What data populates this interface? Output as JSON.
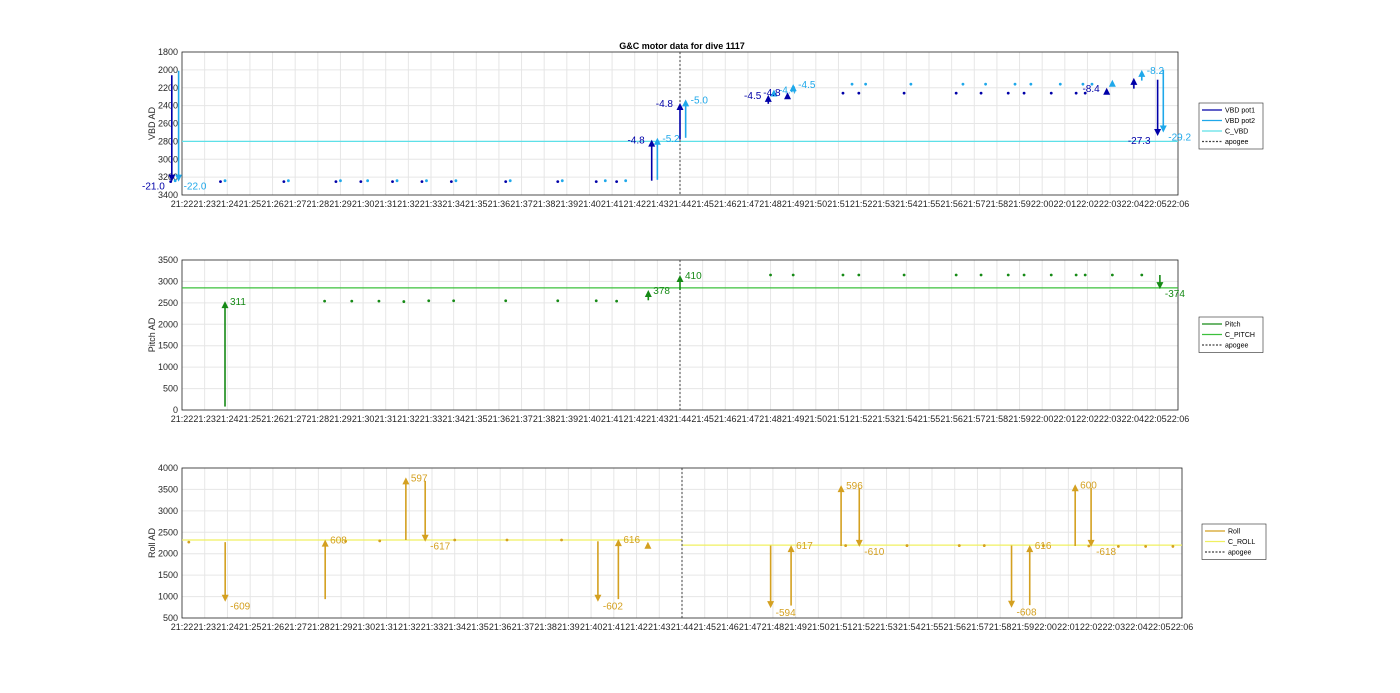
{
  "title": "G&C motor data for dive 1117",
  "colors": {
    "vbd_pot1": "#0000a8",
    "vbd_pot2": "#1fa8ea",
    "c_vbd": "#5ee0e8",
    "pitch": "#168a16",
    "c_pitch": "#3cc03c",
    "roll": "#d4a020",
    "c_roll": "#f0f060",
    "apogee": "#404040",
    "grid": "#e6e6e6"
  },
  "time_ticks": [
    "21:22",
    "21:23",
    "21:24",
    "21:25",
    "21:26",
    "21:27",
    "21:28",
    "21:29",
    "21:30",
    "21:31",
    "21:32",
    "21:33",
    "21:34",
    "21:35",
    "21:36",
    "21:37",
    "21:38",
    "21:39",
    "21:40",
    "21:41",
    "21:42",
    "21:43",
    "21:44",
    "21:45",
    "21:46",
    "21:47",
    "21:48",
    "21:49",
    "21:50",
    "21:51",
    "21:52",
    "21:53",
    "21:54",
    "21:55",
    "21:56",
    "21:57",
    "21:58",
    "21:59",
    "22:00",
    "22:01",
    "22:02",
    "22:03",
    "22:04",
    "22:05",
    "22:06"
  ],
  "chart_data": [
    {
      "type": "line",
      "title": "G&C motor data for dive 1117",
      "ylabel": "VBD AD",
      "xlabel": "",
      "xlim": [
        "21:22",
        "22:06"
      ],
      "ylim": [
        1800,
        3400
      ],
      "y_reversed": true,
      "yticks": [
        1800,
        2000,
        2200,
        2400,
        2600,
        2800,
        3000,
        3200,
        3400
      ],
      "apogee": "21:44",
      "legend": [
        "VBD pot1",
        "VBD pot2",
        "C_VBD",
        "apogee"
      ],
      "legend_position": "right",
      "series": [
        {
          "name": "VBD pot1",
          "points": [
            [
              21.5,
              3250
            ],
            [
              23.7,
              3250
            ],
            [
              26.5,
              3250
            ],
            [
              28.8,
              3250
            ],
            [
              29.9,
              3250
            ],
            [
              31.3,
              3250
            ],
            [
              32.6,
              3250
            ],
            [
              33.9,
              3250
            ],
            [
              36.3,
              3250
            ],
            [
              38.6,
              3250
            ],
            [
              40.3,
              3250
            ],
            [
              41.2,
              3250
            ],
            [
              51.2,
              2260
            ],
            [
              51.9,
              2260
            ],
            [
              53.9,
              2260
            ],
            [
              56.2,
              2260
            ],
            [
              57.3,
              2260
            ],
            [
              58.5,
              2260
            ],
            [
              59.2,
              2260
            ],
            [
              60.4,
              2260
            ],
            [
              61.5,
              2260
            ],
            [
              61.9,
              2260
            ]
          ]
        },
        {
          "name": "VBD pot2",
          "points": [
            [
              21.7,
              3240
            ],
            [
              23.9,
              3240
            ],
            [
              26.7,
              3240
            ],
            [
              29.0,
              3240
            ],
            [
              30.2,
              3240
            ],
            [
              31.5,
              3240
            ],
            [
              32.8,
              3240
            ],
            [
              34.1,
              3240
            ],
            [
              36.5,
              3240
            ],
            [
              38.8,
              3240
            ],
            [
              40.7,
              3240
            ],
            [
              41.6,
              3240
            ],
            [
              51.6,
              2160
            ],
            [
              52.2,
              2160
            ],
            [
              54.2,
              2160
            ],
            [
              56.5,
              2160
            ],
            [
              57.5,
              2160
            ],
            [
              58.8,
              2160
            ],
            [
              59.5,
              2160
            ],
            [
              60.8,
              2160
            ],
            [
              61.8,
              2160
            ],
            [
              62.2,
              2160
            ]
          ]
        },
        {
          "name": "C_VBD",
          "value": 2800
        }
      ],
      "moves": [
        {
          "series": "VBD pot1",
          "t": 21.55,
          "from": 2060,
          "to": 3250,
          "label": "-21.0"
        },
        {
          "series": "VBD pot2",
          "t": 21.85,
          "from": 2010,
          "to": 3250,
          "label": "-22.0"
        },
        {
          "series": "VBD pot1",
          "t": 42.75,
          "from": 3240,
          "to": 2780,
          "label": "-4.8"
        },
        {
          "series": "VBD pot2",
          "t": 43.0,
          "from": 3230,
          "to": 2760,
          "label": "-5.2"
        },
        {
          "series": "VBD pot1",
          "t": 44.0,
          "from": 2780,
          "to": 2370,
          "label": "-4.8"
        },
        {
          "series": "VBD pot2",
          "t": 44.25,
          "from": 2760,
          "to": 2330,
          "label": "-5.0"
        },
        {
          "series": "VBD pot1",
          "t": 47.9,
          "from": 2380,
          "to": 2280,
          "label": "-4.5"
        },
        {
          "series": "VBD pot2",
          "t": 48.15,
          "from": 2280,
          "to": 2220,
          "label": "-4.4"
        },
        {
          "series": "VBD pot1",
          "t": 48.75,
          "from": 2300,
          "to": 2250,
          "label": "-4.8"
        },
        {
          "series": "VBD pot2",
          "t": 49.0,
          "from": 2210,
          "to": 2160,
          "label": "-4.5"
        },
        {
          "series": "VBD pot1",
          "t": 62.85,
          "from": 2250,
          "to": 2200,
          "label": "-8.4"
        },
        {
          "series": "VBD pot2",
          "t": 63.1,
          "from": 2160,
          "to": 2110,
          "label": ""
        },
        {
          "series": "VBD pot1",
          "t": 64.05,
          "from": 2210,
          "to": 2090,
          "label": ""
        },
        {
          "series": "VBD pot2",
          "t": 64.4,
          "from": 2120,
          "to": 2000,
          "label": "-8.2"
        },
        {
          "series": "VBD pot1",
          "t": 65.1,
          "from": 2110,
          "to": 2740,
          "label": "-27.3"
        },
        {
          "series": "VBD pot2",
          "t": 65.35,
          "from": 2000,
          "to": 2700,
          "label": "-29.2"
        }
      ]
    },
    {
      "type": "line",
      "ylabel": "Pitch AD",
      "xlabel": "",
      "xlim": [
        "21:22",
        "22:06"
      ],
      "ylim": [
        0,
        3500
      ],
      "yticks": [
        0,
        500,
        1000,
        1500,
        2000,
        2500,
        3000,
        3500
      ],
      "apogee": "21:44",
      "legend": [
        "Pitch",
        "C_PITCH",
        "apogee"
      ],
      "legend_position": "right",
      "series": [
        {
          "name": "Pitch",
          "points": [
            [
              28.3,
              2540
            ],
            [
              29.5,
              2540
            ],
            [
              30.7,
              2540
            ],
            [
              31.8,
              2530
            ],
            [
              32.9,
              2550
            ],
            [
              34.0,
              2550
            ],
            [
              36.3,
              2550
            ],
            [
              38.6,
              2550
            ],
            [
              40.3,
              2550
            ],
            [
              41.2,
              2540
            ],
            [
              48.0,
              3150
            ],
            [
              49.0,
              3150
            ],
            [
              51.2,
              3150
            ],
            [
              51.9,
              3150
            ],
            [
              53.9,
              3150
            ],
            [
              56.2,
              3150
            ],
            [
              57.3,
              3150
            ],
            [
              58.5,
              3150
            ],
            [
              59.2,
              3150
            ],
            [
              60.4,
              3150
            ],
            [
              61.5,
              3150
            ],
            [
              61.9,
              3150
            ],
            [
              63.1,
              3150
            ],
            [
              64.4,
              3150
            ]
          ]
        },
        {
          "name": "C_PITCH",
          "value": 2850
        }
      ],
      "moves": [
        {
          "series": "Pitch",
          "t": 23.9,
          "from": 80,
          "to": 2540,
          "label": "311"
        },
        {
          "series": "Pitch",
          "t": 42.6,
          "from": 2560,
          "to": 2800,
          "label": "378"
        },
        {
          "series": "Pitch",
          "t": 44.0,
          "from": 2800,
          "to": 3150,
          "label": "410"
        },
        {
          "series": "Pitch",
          "t": 65.2,
          "from": 3150,
          "to": 2820,
          "label": "-374"
        }
      ]
    },
    {
      "type": "line",
      "ylabel": "Roll AD",
      "xlabel": "",
      "xlim": [
        "21:22",
        "22:06"
      ],
      "ylim": [
        500,
        4000
      ],
      "yticks": [
        500,
        1000,
        1500,
        2000,
        2500,
        3000,
        3500,
        4000
      ],
      "apogee": "21:44",
      "legend": [
        "Roll",
        "C_ROLL",
        "apogee"
      ],
      "legend_position": "right",
      "series": [
        {
          "name": "Roll",
          "points": [
            [
              22.3,
              2270
            ],
            [
              29.2,
              2290
            ],
            [
              30.7,
              2300
            ],
            [
              34.0,
              2320
            ],
            [
              36.3,
              2320
            ],
            [
              38.7,
              2320
            ],
            [
              51.2,
              2190
            ],
            [
              53.9,
              2190
            ],
            [
              56.2,
              2190
            ],
            [
              57.3,
              2190
            ],
            [
              59.9,
              2190
            ],
            [
              61.9,
              2180
            ],
            [
              63.2,
              2170
            ],
            [
              64.4,
              2170
            ],
            [
              65.6,
              2170
            ]
          ]
        },
        {
          "name": "C_ROLL",
          "segments": [
            {
              "from": "21:22",
              "to": "21:44",
              "value": 2320
            },
            {
              "from": "21:44",
              "to": "22:06",
              "value": 2200
            }
          ]
        }
      ],
      "moves": [
        {
          "series": "Roll",
          "t": 23.9,
          "from": 2270,
          "to": 880,
          "label": "-609"
        },
        {
          "series": "Roll",
          "t": 28.3,
          "from": 940,
          "to": 2330,
          "label": "608"
        },
        {
          "series": "Roll",
          "t": 31.85,
          "from": 2320,
          "to": 3780,
          "label": "597"
        },
        {
          "series": "Roll",
          "t": 32.7,
          "from": 3700,
          "to": 2280,
          "label": "-617"
        },
        {
          "series": "Roll",
          "t": 40.3,
          "from": 2290,
          "to": 880,
          "label": "-602"
        },
        {
          "series": "Roll",
          "t": 41.2,
          "from": 940,
          "to": 2340,
          "label": "616"
        },
        {
          "series": "Roll",
          "t": 42.5,
          "from": 2180,
          "to": 2280,
          "label": ""
        },
        {
          "series": "Roll",
          "t": 47.9,
          "from": 2190,
          "to": 730,
          "label": "-594"
        },
        {
          "series": "Roll",
          "t": 48.8,
          "from": 790,
          "to": 2200,
          "label": "617"
        },
        {
          "series": "Roll",
          "t": 51.0,
          "from": 2180,
          "to": 3600,
          "label": "596"
        },
        {
          "series": "Roll",
          "t": 51.8,
          "from": 3540,
          "to": 2160,
          "label": "-610"
        },
        {
          "series": "Roll",
          "t": 58.5,
          "from": 2190,
          "to": 740,
          "label": "-608"
        },
        {
          "series": "Roll",
          "t": 59.3,
          "from": 800,
          "to": 2200,
          "label": "616"
        },
        {
          "series": "Roll",
          "t": 61.3,
          "from": 2180,
          "to": 3620,
          "label": "600"
        },
        {
          "series": "Roll",
          "t": 62.0,
          "from": 3540,
          "to": 2160,
          "label": "-618"
        }
      ]
    }
  ]
}
